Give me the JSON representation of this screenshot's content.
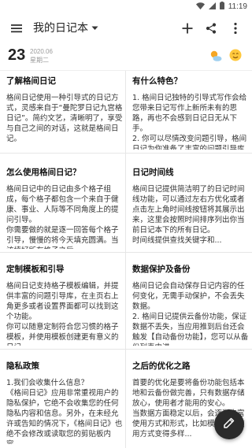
{
  "status": {
    "time": "11:19"
  },
  "appbar": {
    "title": "我的日记本"
  },
  "date": {
    "day": "23",
    "year_month": "2020.06",
    "weekday": "星期二"
  },
  "cards": [
    {
      "title": "了解格间日记",
      "body": "格间日记使用一种引导式的日记方式，灵感来自于“曼陀罗日记九宫格日记”。简约文艺，清晰明了，享受与自己之间的对话，这就是格间日记。"
    },
    {
      "title": "有什么特色？",
      "body": "1. 格间日记独特的引导式写作会给您带来日记写作上新所未有的思路，再也不会感到日记日无从下手。\n2. 你可以尽情改变问题引导，格间日记为你准备了丰富的问题引导库可供选择，当然也..."
    },
    {
      "title": "怎么使用格间日记？",
      "body": "格间日记中的日记由多个格子组成，每个格子都包含一个来自于健康、事业、人际等不同角度上的提问引导。\n你需要做的就是逐一回答每个格子引导，慢慢的将今天填充圆满。当该填好所有格子之后..."
    },
    {
      "title": "日记时间线",
      "body": "格间日记提供简洁明了的日记时间线功能，可以通过左右方优化或者点击左上角时间线按钮将其展示出来，这里会按照时间排序列出你当前日记本下的所有日记。\n时间线提供查找关键字和..."
    },
    {
      "title": "定制模板和引导",
      "body": "格间日记支持格子模板编辑，并提供丰富的问题引导库，在主页右上角更多或者设置界面都可以找到这个功能。\n你可以随意定制符合您习惯的格子模板，并使用模板创建更有意义的日记。"
    },
    {
      "title": "数据保护及备份",
      "body": "格间日记会自动保存日记内容的任何变化，无需手动保护，不会丢失数据。\n2. 格间日记提供云备份功能，保证数据不丢失，当应用推到后台还会触发【自动备份功能】，您可以从备份列表中进..."
    },
    {
      "title": "隐私政策",
      "body": "1.我们会收集什么信息？\n《格间日记》应用非常重视用户的隐私保护，它绝不会收集您的任何隐私内容和信息。另外，在未经允许或告知的情况下，《格间日记》也绝不会修改或读取您的剪贴板内容..."
    },
    {
      "title": "之后的优化之路",
      "body": "首要的优化是要将备份功能包括本地和云备份做完善，只有数据存储放心，使用者才能用的安心。\n当数据方面稳定以后，会逐渐丰富使用方式和形式，比如模板库的使用方式变得多样..."
    }
  ],
  "icons": {
    "menu": "menu-icon",
    "dropdown": "arrow-drop-down-icon",
    "add": "add-icon",
    "share": "share-icon",
    "more": "more-vert-icon",
    "weather": "sunny-cloud-icon",
    "mood": "mood-face-icon",
    "fab": "edit-icon"
  }
}
